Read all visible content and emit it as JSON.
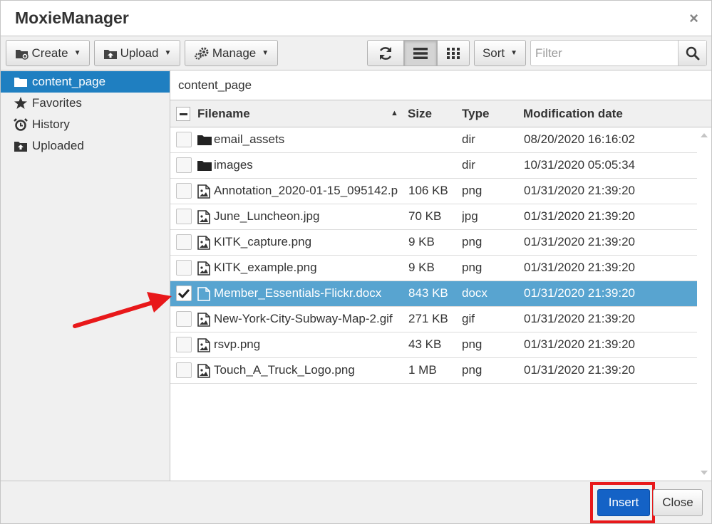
{
  "window": {
    "title": "MoxieManager",
    "close_glyph": "×"
  },
  "toolbar": {
    "create_label": "Create",
    "upload_label": "Upload",
    "manage_label": "Manage",
    "sort_label": "Sort",
    "filter_placeholder": "Filter"
  },
  "sidebar": {
    "items": [
      {
        "label": "content_page",
        "icon": "folder-icon",
        "active": true
      },
      {
        "label": "Favorites",
        "icon": "star-icon",
        "active": false
      },
      {
        "label": "History",
        "icon": "alarm-clock-icon",
        "active": false
      },
      {
        "label": "Uploaded",
        "icon": "upload-icon",
        "active": false
      }
    ]
  },
  "path": {
    "label": "content_page"
  },
  "table": {
    "headers": {
      "filename": "Filename",
      "sort_glyph": "▲",
      "size": "Size",
      "type": "Type",
      "date": "Modification date"
    },
    "rows": [
      {
        "name": "email_assets",
        "size": "",
        "type": "dir",
        "date": "08/20/2020 16:16:02",
        "kind": "folder",
        "checked": false
      },
      {
        "name": "images",
        "size": "",
        "type": "dir",
        "date": "10/31/2020 05:05:34",
        "kind": "folder",
        "checked": false
      },
      {
        "name": "Annotation_2020-01-15_095142.p",
        "size": "106 KB",
        "type": "png",
        "date": "01/31/2020 21:39:20",
        "kind": "image",
        "checked": false
      },
      {
        "name": "June_Luncheon.jpg",
        "size": "70 KB",
        "type": "jpg",
        "date": "01/31/2020 21:39:20",
        "kind": "image",
        "checked": false
      },
      {
        "name": "KITK_capture.png",
        "size": "9 KB",
        "type": "png",
        "date": "01/31/2020 21:39:20",
        "kind": "image",
        "checked": false
      },
      {
        "name": "KITK_example.png",
        "size": "9 KB",
        "type": "png",
        "date": "01/31/2020 21:39:20",
        "kind": "image",
        "checked": false
      },
      {
        "name": "Member_Essentials-Flickr.docx",
        "size": "843 KB",
        "type": "docx",
        "date": "01/31/2020 21:39:20",
        "kind": "file",
        "checked": true
      },
      {
        "name": "New-York-City-Subway-Map-2.gif",
        "size": "271 KB",
        "type": "gif",
        "date": "01/31/2020 21:39:20",
        "kind": "image",
        "checked": false
      },
      {
        "name": "rsvp.png",
        "size": "43 KB",
        "type": "png",
        "date": "01/31/2020 21:39:20",
        "kind": "image",
        "checked": false
      },
      {
        "name": "Touch_A_Truck_Logo.png",
        "size": "1 MB",
        "type": "png",
        "date": "01/31/2020 21:39:20",
        "kind": "image",
        "checked": false
      }
    ]
  },
  "footer": {
    "insert_label": "Insert",
    "close_label": "Close"
  },
  "colors": {
    "accent": "#1f7fc1",
    "selected_row": "#58a4d0",
    "insert_button": "#1462c6",
    "annotation": "#e8181a"
  }
}
